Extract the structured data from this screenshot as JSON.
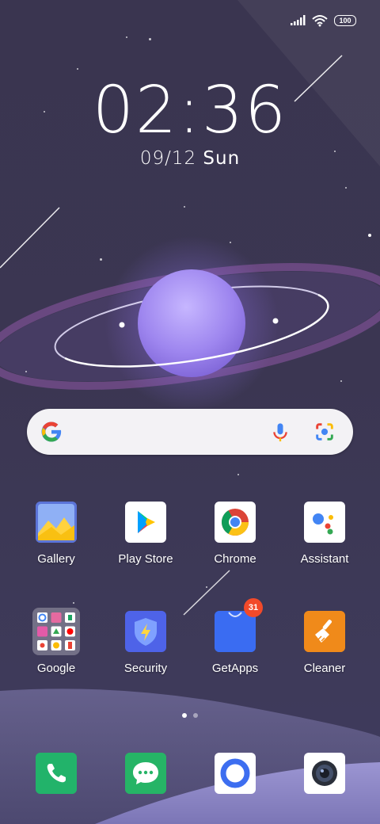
{
  "status": {
    "battery": "100",
    "signal_icon": "signal-icon",
    "wifi_icon": "wifi-icon"
  },
  "clock": {
    "time": "02:36",
    "date": "09/12",
    "day": "Sun"
  },
  "search": {
    "logo_icon": "google-logo-icon",
    "mic_icon": "mic-icon",
    "lens_icon": "lens-icon"
  },
  "apps_row1": [
    {
      "label": "Gallery",
      "icon": "gallery-icon"
    },
    {
      "label": "Play Store",
      "icon": "play-store-icon"
    },
    {
      "label": "Chrome",
      "icon": "chrome-icon"
    },
    {
      "label": "Assistant",
      "icon": "assistant-icon"
    }
  ],
  "apps_row2": [
    {
      "label": "Google",
      "icon": "google-folder-icon"
    },
    {
      "label": "Security",
      "icon": "security-icon"
    },
    {
      "label": "GetApps",
      "icon": "getapps-icon",
      "badge": "31"
    },
    {
      "label": "Cleaner",
      "icon": "cleaner-icon"
    }
  ],
  "page_indicator": {
    "pages": 2,
    "current": 1
  },
  "dock": [
    {
      "icon": "phone-icon"
    },
    {
      "icon": "messages-icon"
    },
    {
      "icon": "browser-icon"
    },
    {
      "icon": "camera-icon"
    }
  ],
  "colors": {
    "wallpaper_top": "#3a3550",
    "planet": "#a48df0",
    "badge": "#f24a2a"
  }
}
